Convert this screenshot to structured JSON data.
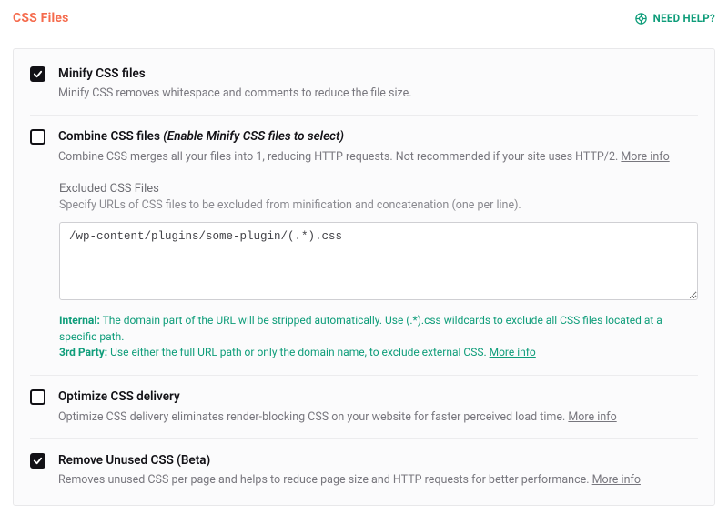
{
  "header": {
    "title": "CSS Files",
    "help_label": "NEED HELP?"
  },
  "settings": {
    "minify": {
      "checked": true,
      "title": "Minify CSS files",
      "desc": "Minify CSS removes whitespace and comments to reduce the file size."
    },
    "combine": {
      "checked": false,
      "title": "Combine CSS files",
      "title_note": "(Enable Minify CSS files to select)",
      "desc": "Combine CSS merges all your files into 1, reducing HTTP requests. Not recommended if your site uses HTTP/2. ",
      "more_info": "More info"
    },
    "excluded": {
      "title": "Excluded CSS Files",
      "desc": "Specify URLs of CSS files to be excluded from minification and concatenation (one per line).",
      "value": "/wp-content/plugins/some-plugin/(.*).css",
      "hint_internal_label": "Internal:",
      "hint_internal_text": " The domain part of the URL will be stripped automatically. Use (.*).css wildcards to exclude all CSS files located at a specific path.",
      "hint_3rd_label": "3rd Party:",
      "hint_3rd_text": " Use either the full URL path or only the domain name, to exclude external CSS. ",
      "hint_more_info": "More info"
    },
    "optimize": {
      "checked": false,
      "title": "Optimize CSS delivery",
      "desc": "Optimize CSS delivery eliminates render-blocking CSS on your website for faster perceived load time. ",
      "more_info": "More info"
    },
    "remove_unused": {
      "checked": true,
      "title": "Remove Unused CSS (Beta)",
      "desc": "Removes unused CSS per page and helps to reduce page size and HTTP requests for better performance. ",
      "more_info": "More info"
    }
  }
}
